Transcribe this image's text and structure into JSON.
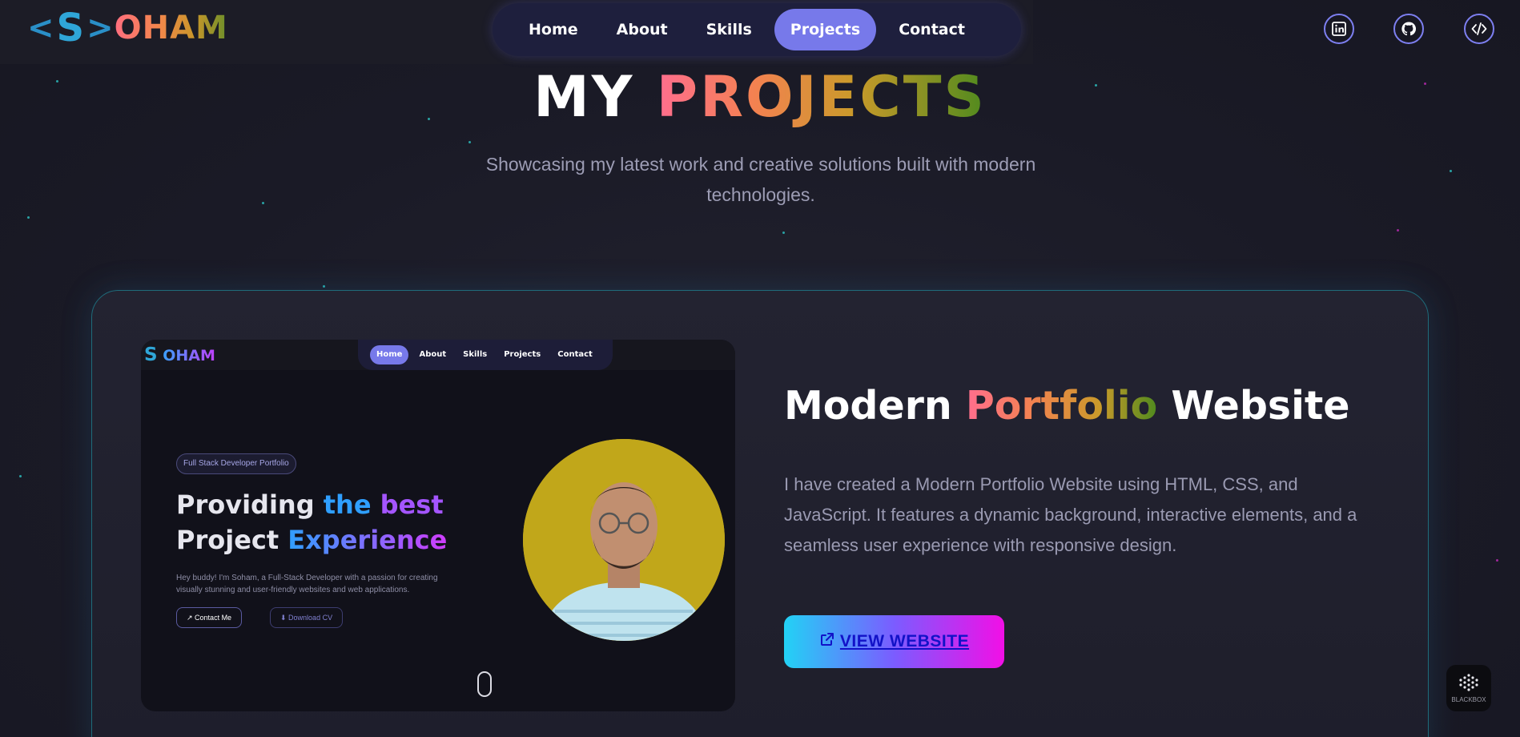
{
  "logo": {
    "bracket_left": "<",
    "letter": "S",
    "bracket_right": ">",
    "text": "OHAM"
  },
  "nav": {
    "items": [
      {
        "label": "Home"
      },
      {
        "label": "About"
      },
      {
        "label": "Skills"
      },
      {
        "label": "Projects",
        "active": true
      },
      {
        "label": "Contact"
      }
    ]
  },
  "social": [
    {
      "icon": "linkedin-icon"
    },
    {
      "icon": "github-icon"
    },
    {
      "icon": "code-icon"
    }
  ],
  "section": {
    "title_word1": "MY",
    "title_word2": "PROJECTS",
    "subtitle": "Showcasing my latest work and creative solutions built with modern technologies."
  },
  "project": {
    "title_part1": "Modern",
    "title_part2": "Portfolio",
    "title_part3": "Website",
    "description": "I have created a Modern Portfolio Website using HTML, CSS, and JavaScript. It features a dynamic background, interactive elements, and a seamless user experience with responsive design.",
    "cta_label": "VIEW WEBSITE"
  },
  "preview": {
    "logo_letter": "S",
    "logo_text": "OHAM",
    "nav": [
      "Home",
      "About",
      "Skills",
      "Projects",
      "Contact"
    ],
    "badge": "Full Stack Developer Portfolio",
    "heading_line1_a": "Providing",
    "heading_line1_b": "the",
    "heading_line1_c": "best",
    "heading_line2_a": "Project",
    "heading_line2_b": "Experience",
    "description": "Hey buddy! I'm Soham, a Full-Stack Developer with a passion for creating visually stunning and user-friendly websites and web applications.",
    "btn_contact": "Contact Me",
    "btn_download": "Download CV"
  },
  "widget": {
    "label": "BLACKBOX"
  },
  "colors": {
    "accent": "#7779ea",
    "background": "#1a1a27",
    "cta_gradient_start": "#22d2f5",
    "cta_gradient_end": "#f20fe6"
  }
}
